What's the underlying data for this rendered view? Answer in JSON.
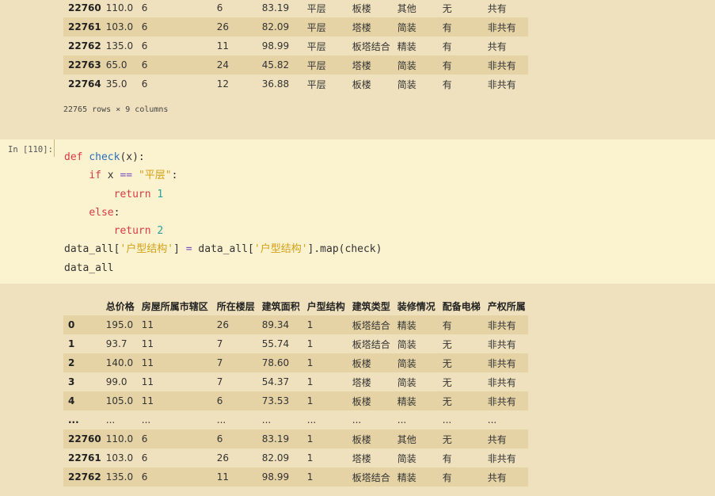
{
  "top_table": {
    "rows": [
      [
        "22760",
        "110.0",
        "6",
        "6",
        "83.19",
        "平层",
        "板楼",
        "其他",
        "无",
        "共有"
      ],
      [
        "22761",
        "103.0",
        "6",
        "26",
        "82.09",
        "平层",
        "塔楼",
        "简装",
        "有",
        "非共有"
      ],
      [
        "22762",
        "135.0",
        "6",
        "11",
        "98.99",
        "平层",
        "板塔结合",
        "精装",
        "有",
        "共有"
      ],
      [
        "22763",
        "65.0",
        "6",
        "24",
        "45.82",
        "平层",
        "塔楼",
        "简装",
        "有",
        "非共有"
      ],
      [
        "22764",
        "35.0",
        "6",
        "12",
        "36.88",
        "平层",
        "板楼",
        "简装",
        "有",
        "非共有"
      ]
    ]
  },
  "rows_info": "22765 rows × 9 columns",
  "cell": {
    "prompt": "In [110]:",
    "code": {
      "l1_def": "def",
      "l1_fn": "check",
      "l1_rest": "(x):",
      "l2_if": "if",
      "l2_x": " x ",
      "l2_eq": "==",
      "l2_str": "\"平层\"",
      "l2_colon": ":",
      "l3_ret": "return",
      "l3_num": "1",
      "l4_else": "else",
      "l4_colon": ":",
      "l5_ret": "return",
      "l5_num": "2",
      "l6_a": "data_all[",
      "l6_s1": "'户型结构'",
      "l6_b": "] ",
      "l6_eq": "=",
      "l6_c": " data_all[",
      "l6_s2": "'户型结构'",
      "l6_d": "].map(check)",
      "l7": "data_all"
    }
  },
  "output_table": {
    "columns": [
      "",
      "总价格",
      "房屋所属市辖区",
      "所在楼层",
      "建筑面积",
      "户型结构",
      "建筑类型",
      "装修情况",
      "配备电梯",
      "产权所属"
    ],
    "rows": [
      [
        "0",
        "195.0",
        "11",
        "26",
        "89.34",
        "1",
        "板塔结合",
        "精装",
        "有",
        "非共有"
      ],
      [
        "1",
        "93.7",
        "11",
        "7",
        "55.74",
        "1",
        "板塔结合",
        "简装",
        "无",
        "非共有"
      ],
      [
        "2",
        "140.0",
        "11",
        "7",
        "78.60",
        "1",
        "板楼",
        "简装",
        "无",
        "非共有"
      ],
      [
        "3",
        "99.0",
        "11",
        "7",
        "54.37",
        "1",
        "塔楼",
        "简装",
        "无",
        "非共有"
      ],
      [
        "4",
        "105.0",
        "11",
        "6",
        "73.53",
        "1",
        "板楼",
        "精装",
        "无",
        "非共有"
      ],
      [
        "...",
        "...",
        "...",
        "...",
        "...",
        "...",
        "...",
        "...",
        "...",
        "..."
      ],
      [
        "22760",
        "110.0",
        "6",
        "6",
        "83.19",
        "1",
        "板楼",
        "其他",
        "无",
        "共有"
      ],
      [
        "22761",
        "103.0",
        "6",
        "26",
        "82.09",
        "1",
        "塔楼",
        "简装",
        "有",
        "非共有"
      ],
      [
        "22762",
        "135.0",
        "6",
        "11",
        "98.99",
        "1",
        "板塔结合",
        "精装",
        "有",
        "共有"
      ]
    ]
  }
}
